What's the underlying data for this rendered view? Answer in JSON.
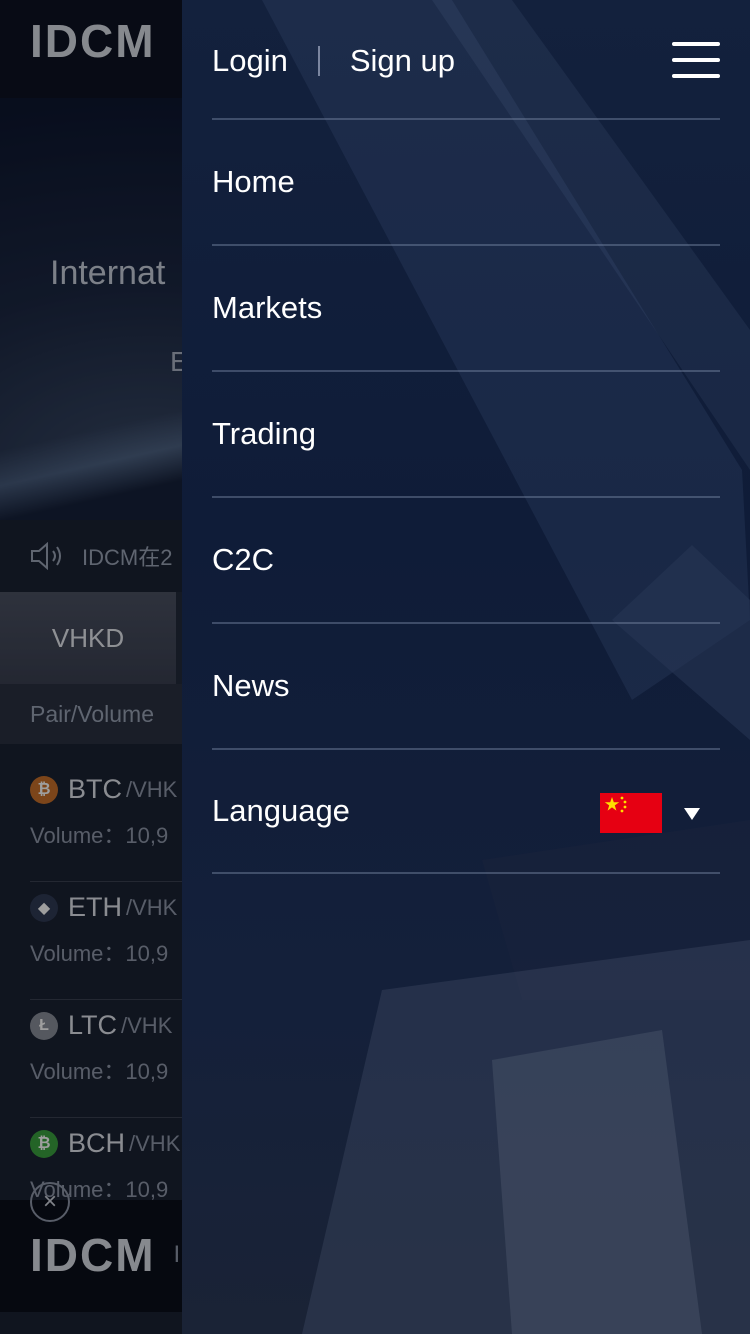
{
  "background_page": {
    "logo_text": "IDCM",
    "hero_title": "Internat",
    "hero_subtitle": "E",
    "notice_text": "IDCM在2",
    "active_tab": "VHKD",
    "list_header": "Pair/Volume",
    "coins": [
      {
        "symbol": "BTC",
        "quote": "/VHK",
        "volume": "Volume：10,9",
        "color": "#c8702a",
        "glyph": "₿"
      },
      {
        "symbol": "ETH",
        "quote": "/VHK",
        "volume": "Volume：10,9",
        "color": "#2f3a55",
        "glyph": "◆"
      },
      {
        "symbol": "LTC",
        "quote": "/VHK",
        "volume": "Volume：10,9",
        "color": "#8a8f99",
        "glyph": "Ł"
      },
      {
        "symbol": "BCH",
        "quote": "/VHK",
        "volume": "Volume：10,9",
        "color": "#3aa23f",
        "glyph": "₿"
      }
    ],
    "banner_logo_text": "IDCM",
    "banner_text_fragment": "I"
  },
  "drawer": {
    "login": "Login",
    "signup": "Sign up",
    "nav": [
      {
        "label": "Home",
        "key": "home"
      },
      {
        "label": "Markets",
        "key": "markets"
      },
      {
        "label": "Trading",
        "key": "trading"
      },
      {
        "label": "C2C",
        "key": "c2c"
      },
      {
        "label": "News",
        "key": "news"
      },
      {
        "label": "Language",
        "key": "language"
      }
    ],
    "language_flag": "china-flag-icon",
    "flag_colors": {
      "field": "#e60012",
      "star": "#ffde00"
    }
  },
  "icons": {
    "menu": "hamburger-menu-icon",
    "speaker": "speaker-icon",
    "close": "close-icon",
    "caret": "caret-down-icon"
  }
}
